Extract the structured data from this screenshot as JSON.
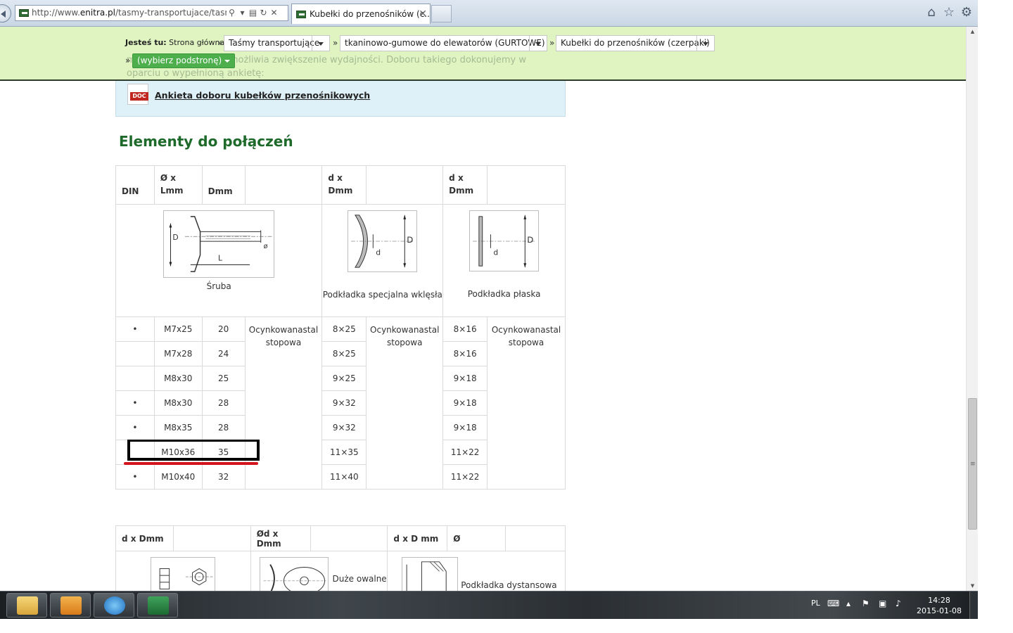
{
  "browser": {
    "url_prefix": "http://www.",
    "url_host": "enitra.pl",
    "url_rest": "/tasmy-transportujace/tasmy-tr",
    "tab_title": "Kubełki do przenośników (c...",
    "icons": [
      "back-icon",
      "search-icon",
      "refresh-icon",
      "stop-icon",
      "home-icon",
      "star-icon",
      "gear-icon"
    ]
  },
  "breadcrumb": {
    "label_bold": "Jesteś tu:",
    "label_rest": " Strona główna",
    "sep": "»",
    "items": [
      "Taśmy transportujące",
      "tkaninowo-gumowe do elewatorów (GURTOWE)",
      "Kubełki do przenośników (czerpaki)"
    ],
    "subpage": "(wybierz podstronę)",
    "faded_text": "mych, a tym samym umożliwia zwiększenie wydajności. Doboru takiego dokonujemy w oparciu o wypełnioną ankietę:"
  },
  "info": {
    "doc_badge": "DOC",
    "link": "Ankieta doboru kubełków przenośnikowych"
  },
  "section_title": "Elementy do połączeń",
  "table1": {
    "headers": [
      "DIN",
      "Ø x Lmm",
      "Dmm",
      "",
      "d x Dmm",
      "",
      "d x Dmm",
      ""
    ],
    "captions": [
      "Śruba",
      "Podkładka specjalna wklęsła",
      "Podkładka płaska"
    ],
    "material": "Ocynkowanastal stopowa",
    "rows": [
      {
        "din": "•",
        "size": "M7x25",
        "d": "20",
        "d1": "8×25",
        "d2": "8×16"
      },
      {
        "din": "",
        "size": "M7x28",
        "d": "24",
        "d1": "8×25",
        "d2": "8×16"
      },
      {
        "din": "",
        "size": "M8x30",
        "d": "25",
        "d1": "9×25",
        "d2": "9×18"
      },
      {
        "din": "•",
        "size": "M8x30",
        "d": "28",
        "d1": "9×32",
        "d2": "9×18"
      },
      {
        "din": "•",
        "size": "M8x35",
        "d": "28",
        "d1": "9×32",
        "d2": "9×18"
      },
      {
        "din": "",
        "size": "M10x36",
        "d": "35",
        "d1": "11×35",
        "d2": "11×22"
      },
      {
        "din": "•",
        "size": "M10x40",
        "d": "32",
        "d1": "11×40",
        "d2": "11×22"
      }
    ],
    "diagram_labels": {
      "D": "D",
      "L": "L",
      "d": "d"
    }
  },
  "table2": {
    "headers": [
      "d x Dmm",
      "",
      "Ød x Dmm",
      "",
      "d x D mm",
      "Ø",
      ""
    ],
    "captions": [
      "Duże owalne",
      "Podkładka dystansowa"
    ]
  },
  "taskbar": {
    "lang": "PL",
    "time": "14:28",
    "date": "2015-01-08",
    "apps": [
      "explorer-icon",
      "outlook-icon",
      "internet-explorer-icon",
      "excel-icon"
    ]
  }
}
